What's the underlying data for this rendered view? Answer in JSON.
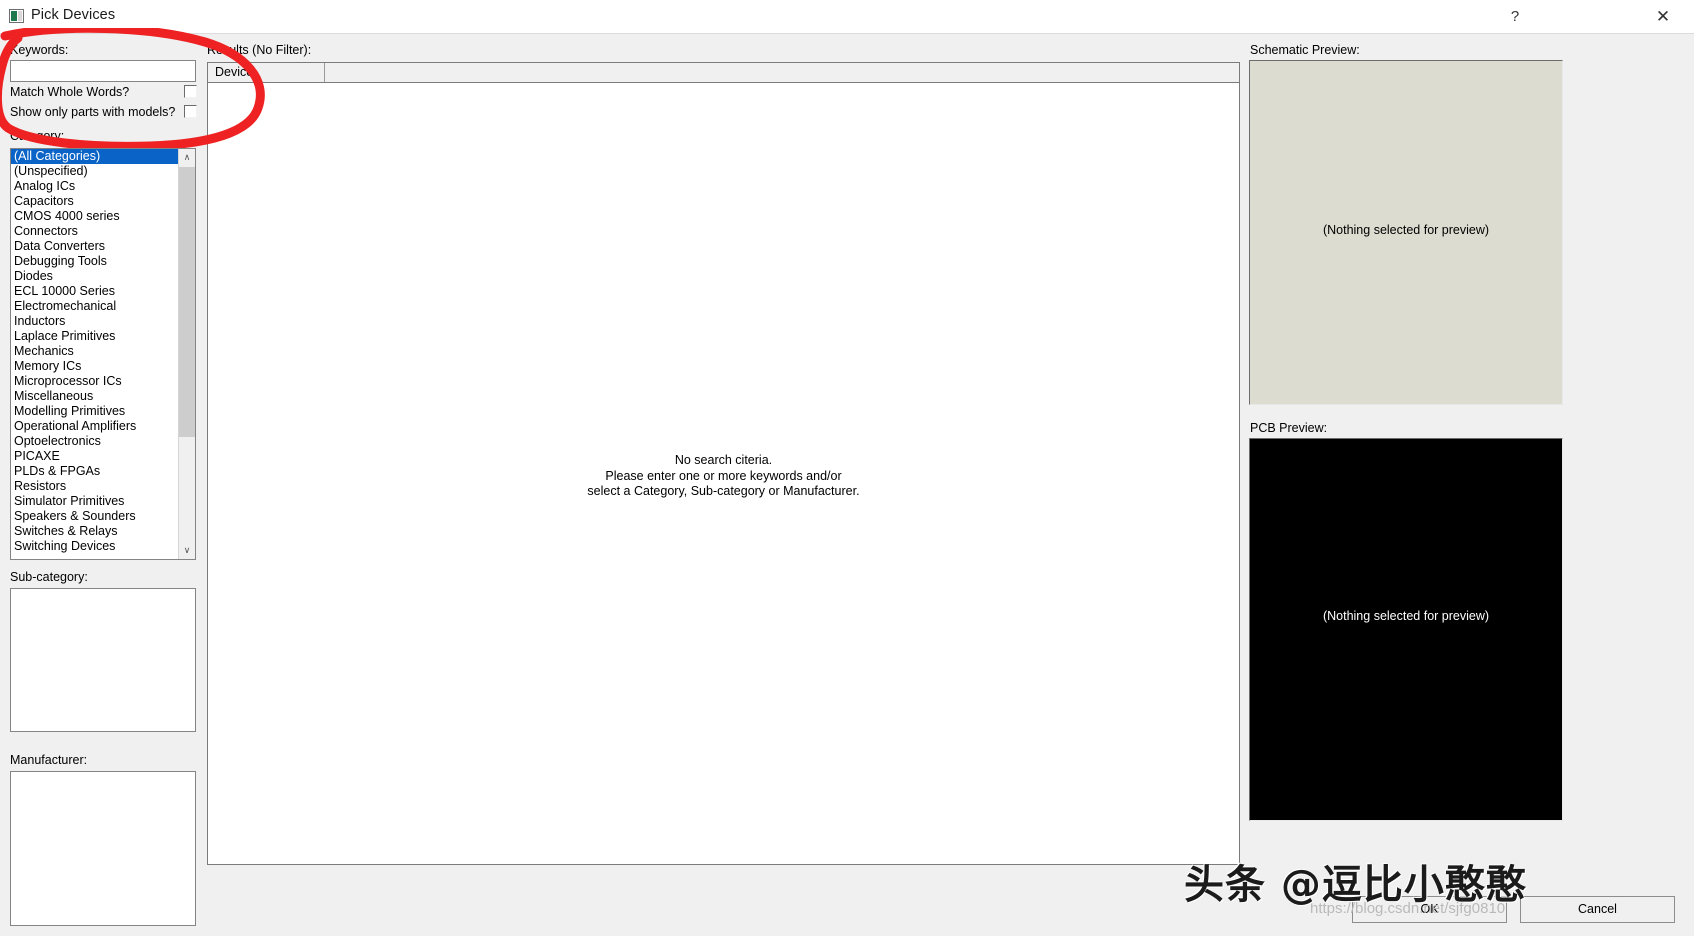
{
  "window": {
    "title": "Pick Devices",
    "icon": "app-icon",
    "help_label": "?",
    "close_label": "✕"
  },
  "left": {
    "keywords_label": "Keywords:",
    "keywords_value": "",
    "keywords_placeholder": "",
    "match_whole_words_label": "Match Whole Words?",
    "match_whole_words_checked": false,
    "show_only_models_label": "Show only parts with models?",
    "show_only_models_checked": false,
    "category_label": "Category:",
    "categories": [
      "(All Categories)",
      "(Unspecified)",
      "Analog ICs",
      "Capacitors",
      "CMOS 4000 series",
      "Connectors",
      "Data Converters",
      "Debugging Tools",
      "Diodes",
      "ECL 10000 Series",
      "Electromechanical",
      "Inductors",
      "Laplace Primitives",
      "Mechanics",
      "Memory ICs",
      "Microprocessor ICs",
      "Miscellaneous",
      "Modelling Primitives",
      "Operational Amplifiers",
      "Optoelectronics",
      "PICAXE",
      "PLDs & FPGAs",
      "Resistors",
      "Simulator Primitives",
      "Speakers & Sounders",
      "Switches & Relays",
      "Switching Devices"
    ],
    "selected_category": "(All Categories)",
    "subcategory_label": "Sub-category:",
    "subcategory_items": [],
    "manufacturer_label": "Manufacturer:",
    "manufacturer_items": [],
    "scroll_up_glyph": "∧",
    "scroll_down_glyph": "∨"
  },
  "results": {
    "header_label": "Results (No Filter):",
    "columns": [
      "Device",
      ""
    ],
    "rows": [],
    "empty_message_line1": "No search citeria.",
    "empty_message_line2": "Please enter one or more keywords and/or",
    "empty_message_line3": "select a Category, Sub-category or Manufacturer."
  },
  "previews": {
    "schematic_label": "Schematic Preview:",
    "schematic_placeholder": "(Nothing selected for preview)",
    "schematic_bg": "#dcdcd0",
    "pcb_label": "PCB Preview:",
    "pcb_placeholder": "(Nothing selected for preview)",
    "pcb_bg": "#000000",
    "pcb_text_color": "#ffffff"
  },
  "footer": {
    "ok_label": "OK",
    "cancel_label": "Cancel"
  },
  "annotation": {
    "color": "#ee2222",
    "shape": "hand-drawn-ellipse"
  },
  "watermark": {
    "text": "头条 @逗比小憨憨",
    "url": "https://blog.csdn.net/sjfg0810"
  }
}
